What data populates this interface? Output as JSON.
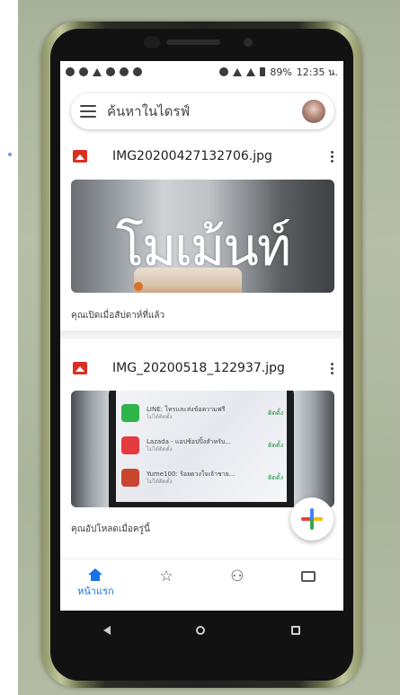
{
  "status_bar": {
    "battery": "89%",
    "time": "12:35 น."
  },
  "search": {
    "placeholder": "ค้นหาในไดรฟ์"
  },
  "files": [
    {
      "name": "IMG20200427132706.jpg",
      "thumbnail_text": "โมเม้นท์",
      "meta": "คุณเปิดเมื่อสัปดาห์ที่แล้ว"
    },
    {
      "name": "IMG_20200518_122937.jpg",
      "meta": "คุณอัปโหลดเมื่อครู่นี้",
      "thumbnail_apps": [
        {
          "title": "LINE: โทรและส่งข้อความฟรี",
          "sub": "ไม่ได้ติดตั้ง",
          "action": "ติดตั้ง",
          "color": "#2fb44a"
        },
        {
          "title": "Lazada - แอปช้อปปิ้งสำหรับ...",
          "sub": "ไม่ได้ติดตั้ง",
          "action": "ติดตั้ง",
          "color": "#e53a3f"
        },
        {
          "title": "Yume100: ร้อยดวงใจเจ้าชาย...",
          "sub": "ไม่ได้ติดตั้ง",
          "action": "ติดตั้ง",
          "color": "#c8452e"
        }
      ]
    }
  ],
  "bottom_nav": {
    "home_label": "หน้าแรก"
  },
  "colors": {
    "accent": "#1a73e8",
    "image_icon": "#d93025"
  }
}
